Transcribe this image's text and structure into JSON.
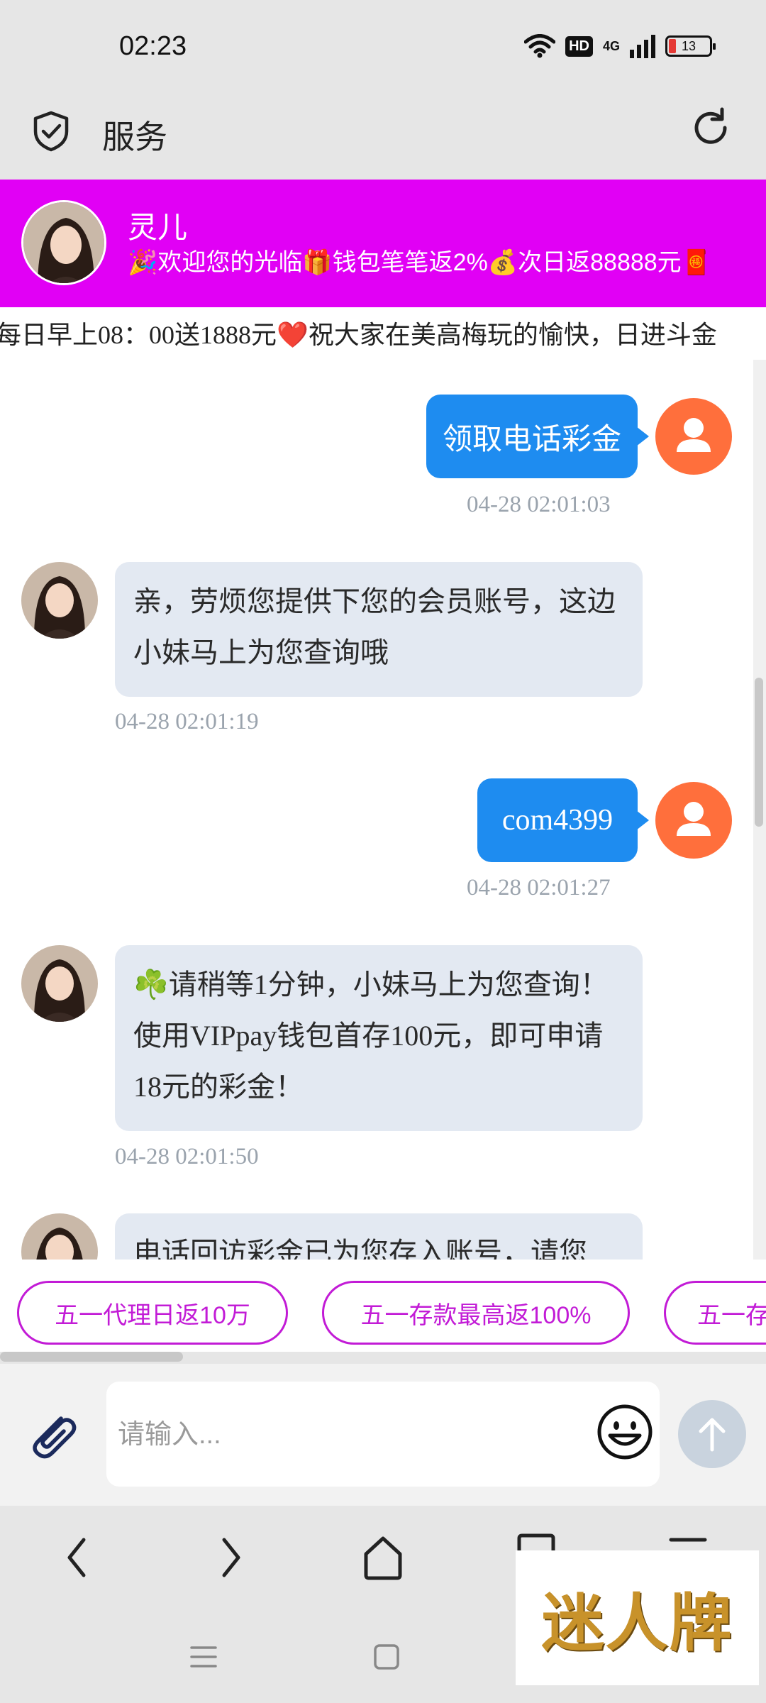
{
  "status_bar": {
    "time": "02:23",
    "network": "4G",
    "hd": "HD",
    "battery": "13"
  },
  "header": {
    "title": "服务"
  },
  "agent": {
    "name": "灵儿",
    "greeting": "🎉欢迎您的光临🎁钱包笔笔返2%💰次日返88888元🧧"
  },
  "marquee": {
    "text": "每日早上08：00送1888元❤️祝大家在美高梅玩的愉快，日进斗金"
  },
  "messages": [
    {
      "from": "user",
      "text": "领取电话彩金",
      "time": "04-28 02:01:03"
    },
    {
      "from": "agent",
      "text": "亲，劳烦您提供下您的会员账号，这边小妹马上为您查询哦",
      "time": "04-28 02:01:19"
    },
    {
      "from": "user",
      "text": "com4399",
      "time": "04-28 02:01:27"
    },
    {
      "from": "agent",
      "text": "☘️请稍等1分钟，小妹马上为您查询！使用VIPpay钱包首存100元，即可申请18元的彩金！",
      "time": "04-28 02:01:50"
    },
    {
      "from": "agent",
      "text": "电话回访彩金已为您存入账号，请您"
    }
  ],
  "quick_replies": [
    "五一代理日返10万",
    "五一存款最高返100%",
    "五一存"
  ],
  "input": {
    "placeholder": "请输入..."
  },
  "watermark": "迷人牌",
  "colors": {
    "banner": "#e100f5",
    "user_bubble": "#1e8cf0",
    "agent_bubble": "#e3e9f2",
    "chip": "#c21bd6",
    "user_avatar": "#ff6f3c"
  }
}
